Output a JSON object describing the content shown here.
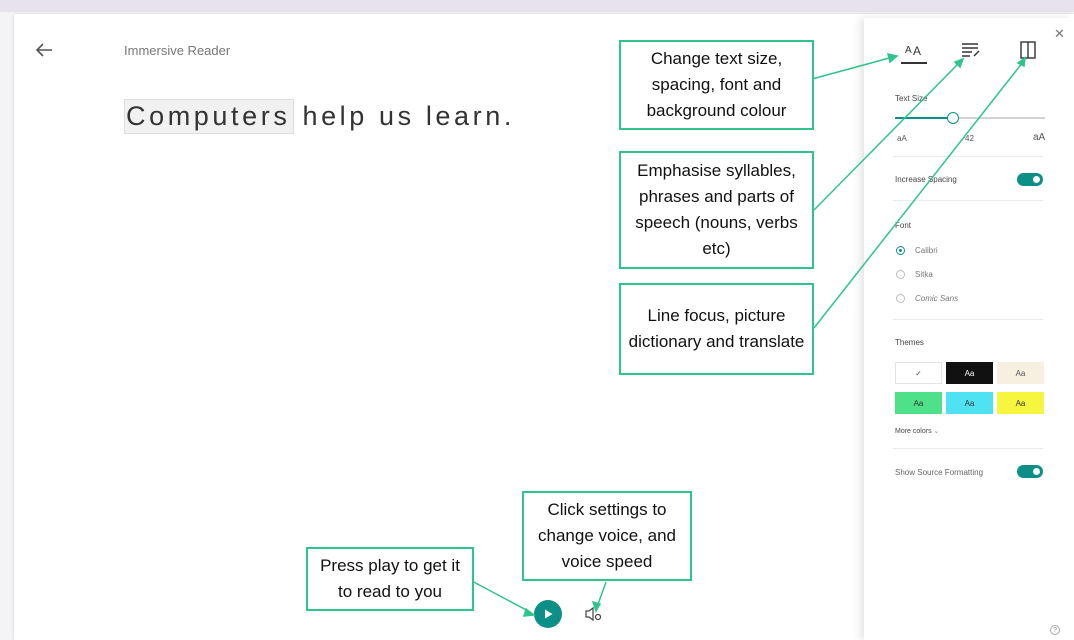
{
  "app": {
    "title": "Immersive Reader"
  },
  "content": {
    "highlighted_word": "Computers",
    "rest_of_line": "help us learn."
  },
  "panel": {
    "tabs": [
      "text-preferences",
      "grammar-options",
      "reading-preferences"
    ],
    "text_size": {
      "label": "Text Size",
      "value_percent": 38,
      "small_label": "aA",
      "mid_label": "42",
      "large_label": "aA"
    },
    "increase_spacing": {
      "label": "Increase Spacing",
      "on": true
    },
    "font": {
      "label": "Font",
      "options": [
        "Calibri",
        "Sitka",
        "Comic Sans"
      ],
      "selected": "Calibri"
    },
    "themes": {
      "label": "Themes",
      "swatches": [
        {
          "label": "✓",
          "color": "#ffffff",
          "text_color": "#555555"
        },
        {
          "label": "Aa",
          "color": "#111111",
          "text_color": "#ffffff"
        },
        {
          "label": "Aa",
          "color": "#f7f0e1",
          "text_color": "#555555"
        },
        {
          "label": "Aa",
          "color": "#4fe08a",
          "text_color": "#333333"
        },
        {
          "label": "Aa",
          "color": "#4fe2f2",
          "text_color": "#333333"
        },
        {
          "label": "Aa",
          "color": "#f6f63e",
          "text_color": "#333333"
        }
      ],
      "more_colors": "More colors"
    },
    "show_source_formatting": {
      "label": "Show Source Formatting",
      "on": true
    }
  },
  "callouts": {
    "text_options": "Change text size, spacing, font and background colour",
    "grammar": "Emphasise syllables, phrases and parts of speech (nouns, verbs etc)",
    "reading": "Line focus, picture dictionary and translate",
    "voice": "Click settings to change voice, and voice speed",
    "play": "Press play to get it to read to you"
  },
  "colors": {
    "accent": "#0b8f86",
    "callout_border": "#2ec48b"
  },
  "icons": [
    "back-arrow-icon",
    "close-icon",
    "play-icon",
    "voice-settings-icon",
    "help-icon"
  ]
}
